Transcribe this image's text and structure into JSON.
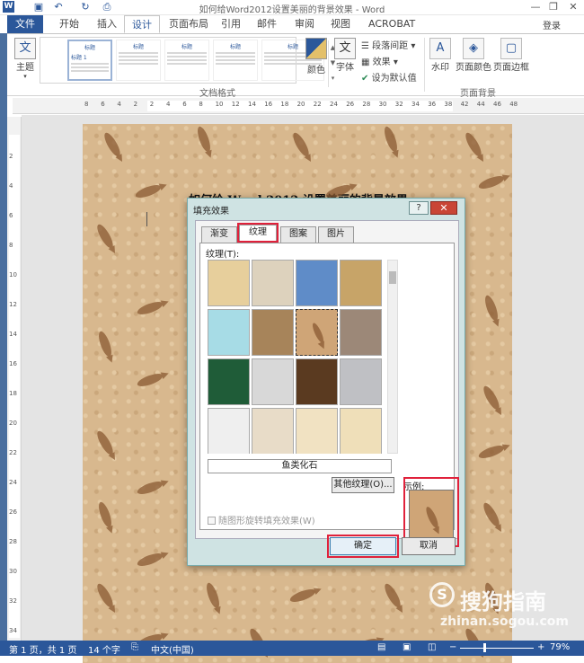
{
  "app": {
    "title": "如何给Word2012设置美丽的背景效果 - Word",
    "icon_letter": "W",
    "login": "登录",
    "quick_access": [
      "save-icon",
      "undo-icon",
      "redo-icon",
      "print-preview-icon"
    ],
    "window_controls": [
      "minimize-icon",
      "restore-icon",
      "close-icon"
    ],
    "window_glyphs": {
      "minimize": "—",
      "restore": "❐",
      "close": "✕"
    }
  },
  "tabs": [
    {
      "label": "文件",
      "key": "file"
    },
    {
      "label": "开始",
      "key": "home"
    },
    {
      "label": "插入",
      "key": "insert"
    },
    {
      "label": "设计",
      "key": "design",
      "active": true
    },
    {
      "label": "页面布局",
      "key": "layout"
    },
    {
      "label": "引用",
      "key": "references"
    },
    {
      "label": "邮件",
      "key": "mailings"
    },
    {
      "label": "审阅",
      "key": "review"
    },
    {
      "label": "视图",
      "key": "view"
    },
    {
      "label": "ACROBAT",
      "key": "acrobat"
    }
  ],
  "ribbon": {
    "theme_label": "主题",
    "gallery_items": [
      {
        "heading": "标题",
        "sub": "标题 1"
      },
      {
        "heading": "标题",
        "sub": ""
      },
      {
        "heading": "标题",
        "sub": ""
      },
      {
        "heading": "标题",
        "sub": ""
      },
      {
        "heading": "标题",
        "sub": ""
      },
      {
        "heading": "标题",
        "sub": ""
      }
    ],
    "doc_format_label": "文档格式",
    "colors_label": "颜色",
    "fonts_label": "字体",
    "fonts_glyph": "文",
    "paragraph_spacing": "段落间距",
    "effects": "效果",
    "set_default": "设为默认值",
    "watermark_label": "水印",
    "page_color_label": "页面颜色",
    "page_border_label": "页面边框",
    "page_bg_label": "页面背景"
  },
  "ruler": {
    "h_numbers": [
      "8",
      "6",
      "4",
      "2",
      "2",
      "4",
      "6",
      "8",
      "10",
      "12",
      "14",
      "16",
      "18",
      "20",
      "22",
      "24",
      "26",
      "28",
      "30",
      "32",
      "34",
      "36",
      "38",
      "42",
      "44",
      "46",
      "48"
    ],
    "v_numbers": [
      "2",
      "4",
      "6",
      "8",
      "10",
      "12",
      "14",
      "16",
      "18",
      "20",
      "22",
      "24",
      "26",
      "28",
      "30",
      "32",
      "34"
    ]
  },
  "document": {
    "title": "如何给 Word 2012 设置美丽的背景效果"
  },
  "dialog": {
    "title": "填充效果",
    "help": "?",
    "close": "✕",
    "tabs": [
      "渐变",
      "纹理",
      "图案",
      "图片"
    ],
    "active_tab": "纹理",
    "texture_label": "纹理(T):",
    "textures": [
      {
        "color": "#e7cf9c"
      },
      {
        "color": "#ddd2bd"
      },
      {
        "color": "#5f8cc8"
      },
      {
        "color": "#c7a468"
      },
      {
        "color": "#a7dce6"
      },
      {
        "color": "#a7845a"
      },
      {
        "color": "#cfa577"
      },
      {
        "color": "#9c8878"
      },
      {
        "color": "#1f5c38"
      },
      {
        "color": "#d8d8d8"
      },
      {
        "color": "#5a3a20"
      },
      {
        "color": "#bfc0c4"
      },
      {
        "color": "#efefef"
      },
      {
        "color": "#e8dcc8"
      },
      {
        "color": "#f1e2c2"
      },
      {
        "color": "#efdfb9"
      }
    ],
    "selected_texture_name": "鱼类化石",
    "more_textures": "其他纹理(O)...",
    "preview_label": "示例:",
    "rotate_label": "随图形旋转填充效果(W)",
    "ok": "确定",
    "cancel": "取消"
  },
  "status": {
    "page": "第 1 页，共 1 页",
    "words": "14 个字",
    "language": "中文(中国)",
    "zoom_minus": "−",
    "zoom_plus": "+",
    "zoom": "79%"
  },
  "watermark": {
    "logo_glyph": "S",
    "text": "搜狗指南",
    "url": "zhinan.sogou.com"
  }
}
